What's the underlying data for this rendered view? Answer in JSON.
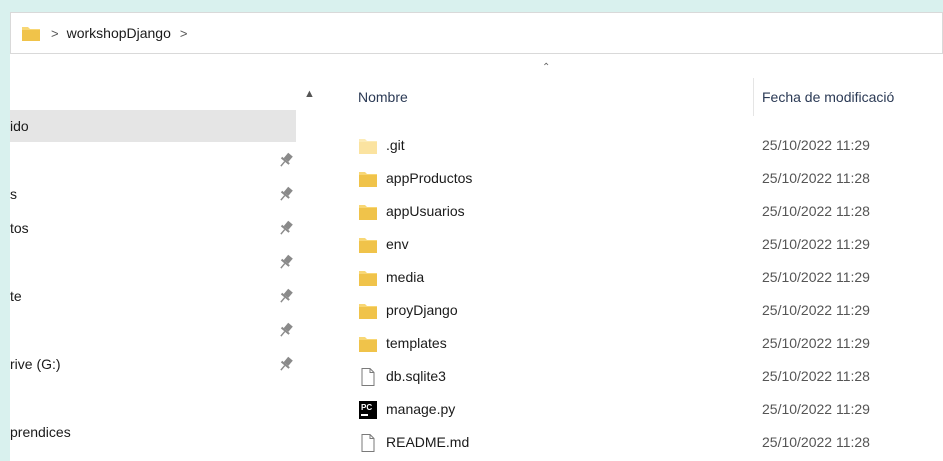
{
  "breadcrumb": {
    "segment": "workshopDjango"
  },
  "nav": {
    "items": [
      {
        "label": "ido",
        "selected": true,
        "pinned": false
      },
      {
        "label": "",
        "selected": false,
        "pinned": true
      },
      {
        "label": "s",
        "selected": false,
        "pinned": true
      },
      {
        "label": "tos",
        "selected": false,
        "pinned": true
      },
      {
        "label": "",
        "selected": false,
        "pinned": true
      },
      {
        "label": "te",
        "selected": false,
        "pinned": true
      },
      {
        "label": "",
        "selected": false,
        "pinned": true
      },
      {
        "label": "rive (G:)",
        "selected": false,
        "pinned": true
      },
      {
        "label": "",
        "selected": false,
        "pinned": false
      },
      {
        "label": "prendices",
        "selected": false,
        "pinned": false
      }
    ]
  },
  "columns": {
    "name": "Nombre",
    "date": "Fecha de modificació"
  },
  "files": [
    {
      "name": ".git",
      "date": "25/10/2022 11:29",
      "icon": "folder-light-icon"
    },
    {
      "name": "appProductos",
      "date": "25/10/2022 11:28",
      "icon": "folder-icon"
    },
    {
      "name": "appUsuarios",
      "date": "25/10/2022 11:28",
      "icon": "folder-icon"
    },
    {
      "name": "env",
      "date": "25/10/2022 11:29",
      "icon": "folder-icon"
    },
    {
      "name": "media",
      "date": "25/10/2022 11:29",
      "icon": "folder-icon"
    },
    {
      "name": "proyDjango",
      "date": "25/10/2022 11:29",
      "icon": "folder-icon"
    },
    {
      "name": "templates",
      "date": "25/10/2022 11:29",
      "icon": "folder-icon"
    },
    {
      "name": "db.sqlite3",
      "date": "25/10/2022 11:28",
      "icon": "file-icon"
    },
    {
      "name": "manage.py",
      "date": "25/10/2022 11:29",
      "icon": "pycharm-icon"
    },
    {
      "name": "README.md",
      "date": "25/10/2022 11:28",
      "icon": "file-icon"
    }
  ],
  "colors": {
    "folder": "#f8d775",
    "folder_light": "#fcebb6",
    "selected": "#e5e5e5",
    "background": "#d9f1ee"
  }
}
